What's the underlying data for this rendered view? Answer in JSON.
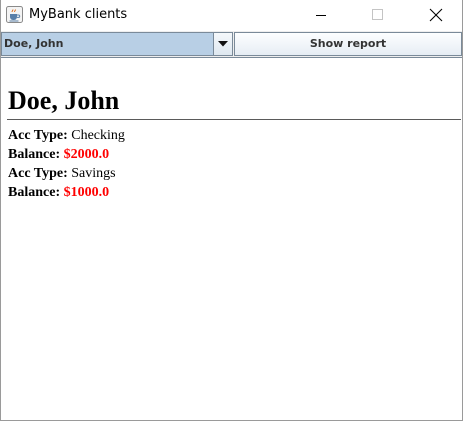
{
  "window": {
    "title": "MyBank clients",
    "icon": "java-cup-icon",
    "controls": [
      "minimize-icon",
      "maximize-icon",
      "close-icon"
    ]
  },
  "toolbar": {
    "client_select": {
      "selected": "Doe, John",
      "icon": "chevron-down-icon"
    },
    "show_report_label": "Show report"
  },
  "report": {
    "client_name": "Doe, John",
    "labels": {
      "acc_type": "Acc Type:",
      "balance": "Balance:"
    },
    "accounts": [
      {
        "type": "Checking",
        "balance": "$2000.0"
      },
      {
        "type": "Savings",
        "balance": "$1000.0"
      }
    ]
  },
  "colors": {
    "balance_text": "#ff0000",
    "combo_background": "#b8cfe5",
    "border": "#7a8a99"
  }
}
